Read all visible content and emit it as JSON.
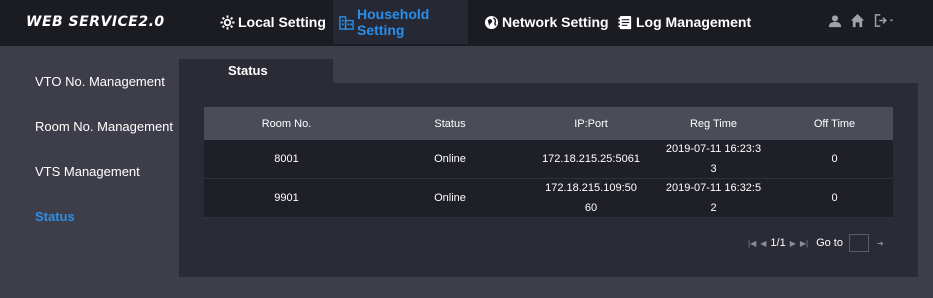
{
  "header": {
    "brand": "WEB SERVICE2.0",
    "tabs": [
      {
        "label": "Local Setting",
        "icon": "gear-icon"
      },
      {
        "label": "Household Setting",
        "icon": "building-icon"
      },
      {
        "label": "Network Setting",
        "icon": "globe-icon"
      },
      {
        "label": "Log Management",
        "icon": "log-icon"
      }
    ],
    "active_tab": "Household Setting",
    "right_icons": [
      "user-icon",
      "home-icon",
      "logout-icon"
    ]
  },
  "sidebar": {
    "items": [
      {
        "label": "VTO No. Management"
      },
      {
        "label": "Room No. Management"
      },
      {
        "label": "VTS Management"
      },
      {
        "label": "Status"
      }
    ],
    "active_item": "Status"
  },
  "panel": {
    "tab_label": "Status"
  },
  "table": {
    "columns": [
      "Room No.",
      "Status",
      "IP:Port",
      "Reg Time",
      "Off Time"
    ],
    "rows": [
      {
        "room": "8001",
        "status": "Online",
        "ip_port": "172.18.215.25:5061",
        "reg_time": "2019-07-11 16:23:33",
        "off_time": "0"
      },
      {
        "room": "9901",
        "status": "Online",
        "ip_port": "172.18.215.109:5060",
        "reg_time": "2019-07-11 16:32:52",
        "off_time": "0"
      }
    ]
  },
  "pagination": {
    "page_info": "1/1",
    "goto_label": "Go to",
    "goto_value": ""
  },
  "colors": {
    "accent": "#2b8ee8",
    "background": "#3d3e49",
    "topbar": "#1b1c22",
    "panel": "#2a2b34",
    "table_header": "#4a4c57",
    "table_row": "#1f2027"
  }
}
